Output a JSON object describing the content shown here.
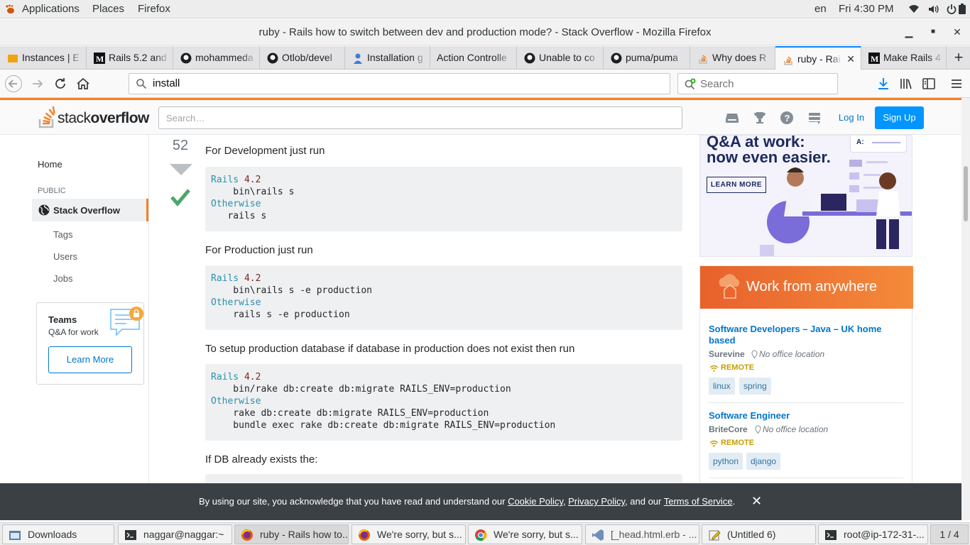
{
  "topbar": {
    "applications": "Applications",
    "places": "Places",
    "firefox": "Firefox",
    "lang": "en",
    "clock": "Fri  4:30 PM"
  },
  "window": {
    "title": "ruby - Rails how to switch between dev and production mode? - Stack Overflow - Mozilla Firefox"
  },
  "tabs": [
    {
      "label": "Instances | E",
      "icon": "aws-icon"
    },
    {
      "label": "Rails 5.2 and",
      "icon": "medium-icon"
    },
    {
      "label": "mohammeda",
      "icon": "github-icon"
    },
    {
      "label": "Otlob/devel",
      "icon": "github-icon"
    },
    {
      "label": "Installation g",
      "icon": "person-icon"
    },
    {
      "label": "Action Controlle",
      "icon": ""
    },
    {
      "label": "Unable to co",
      "icon": "github-icon"
    },
    {
      "label": "puma/puma",
      "icon": "github-icon"
    },
    {
      "label": "Why does R",
      "icon": "stackoverflow-icon"
    },
    {
      "label": "ruby - Rai",
      "icon": "stackoverflow-icon"
    },
    {
      "label": "Make Rails 4",
      "icon": "medium-icon"
    }
  ],
  "navbar": {
    "url_text": "install",
    "search_placeholder": "Search"
  },
  "so": {
    "logo_pre": "stack",
    "logo_bold": "overflow",
    "search_placeholder": "Search…",
    "login": "Log In",
    "signup": "Sign Up"
  },
  "leftnav": {
    "home": "Home",
    "public": "PUBLIC",
    "stackoverflow": "Stack Overflow",
    "tags": "Tags",
    "users": "Users",
    "jobs": "Jobs",
    "teams_title": "Teams",
    "teams_sub": "Q&A for work",
    "teams_btn": "Learn More"
  },
  "answer": {
    "votes": "52",
    "p1": "For Development just run",
    "code1": [
      {
        "kw": "Rails",
        "num": " 4.2",
        "rest": ""
      },
      {
        "kw": "",
        "num": "",
        "rest": "    bin\\rails s"
      },
      {
        "kw": "Otherwise",
        "num": "",
        "rest": ""
      },
      {
        "kw": "",
        "num": "",
        "rest": "   rails s"
      }
    ],
    "p2": "For Production just run",
    "code2": [
      {
        "kw": "Rails",
        "num": " 4.2",
        "rest": ""
      },
      {
        "kw": "",
        "num": "",
        "rest": "    bin\\rails s -e production"
      },
      {
        "kw": "Otherwise",
        "num": "",
        "rest": ""
      },
      {
        "kw": "",
        "num": "",
        "rest": "    rails s -e production"
      }
    ],
    "p3": "To setup production database if database in production does not exist then run",
    "code3": [
      {
        "kw": "Rails",
        "num": " 4.2",
        "rest": ""
      },
      {
        "kw": "",
        "num": "",
        "rest": "    bin/rake db:create db:migrate RAILS_ENV=production"
      },
      {
        "kw": "Otherwise",
        "num": "",
        "rest": ""
      },
      {
        "kw": "",
        "num": "",
        "rest": "    rake db:create db:migrate RAILS_ENV=production"
      },
      {
        "kw": "",
        "num": "",
        "rest": "    bundle exec rake db:create db:migrate RAILS_ENV=production"
      }
    ],
    "p4": "If DB already exists the:"
  },
  "ad": {
    "line1": "Q&A at work:",
    "line2": "now even easier.",
    "button": "LEARN MORE",
    "card_label": "A:"
  },
  "jobs": {
    "header": "Work from anywhere",
    "items": [
      {
        "title": "Software Developers – Java – UK home based",
        "company": "Surevine",
        "location": "No office location",
        "remote": "REMOTE",
        "tags": [
          "linux",
          "spring"
        ]
      },
      {
        "title": "Software Engineer",
        "company": "BriteCore",
        "location": "No office location",
        "remote": "REMOTE",
        "tags": [
          "python",
          "django"
        ]
      }
    ]
  },
  "cookie": {
    "pre": "By using our site, you acknowledge that you have read and understand our ",
    "cookie_policy": "Cookie Policy",
    "sep1": ", ",
    "privacy_policy": "Privacy Policy",
    "sep2": ", and our ",
    "terms": "Terms of Service",
    "end": "."
  },
  "taskbar": {
    "items": [
      {
        "label": "Downloads"
      },
      {
        "label": "naggar@naggar:~"
      },
      {
        "label": "ruby - Rails how to..."
      },
      {
        "label": "We're sorry, but s..."
      },
      {
        "label": "We're sorry, but s..."
      },
      {
        "label": "[_head.html.erb - ..."
      },
      {
        "label": "(Untitled 6)"
      },
      {
        "label": "root@ip-172-31-..."
      }
    ],
    "pager": "1 / 4"
  },
  "colors": {
    "so_orange": "#f48024",
    "so_blue": "#0095ff",
    "link_blue": "#0077cc",
    "accept_green": "#48a868",
    "firefox_blue": "#0a84ff"
  }
}
